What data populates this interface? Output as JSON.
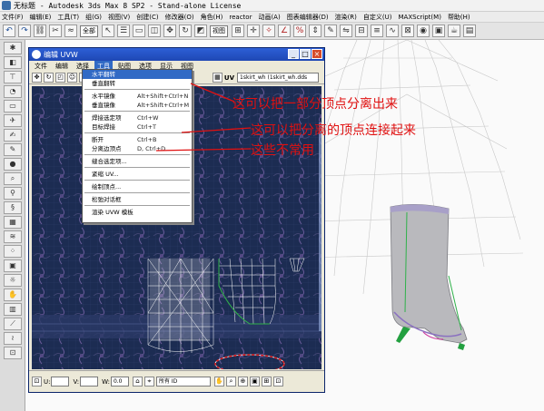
{
  "window": {
    "title": "无标题  -  Autodesk 3ds Max 8 SP2  -  Stand-alone License"
  },
  "menubar": {
    "items": [
      "文件(F)",
      "编辑(E)",
      "工具(T)",
      "组(G)",
      "视图(V)",
      "创建(C)",
      "修改器(O)",
      "角色(H)",
      "reactor",
      "动画(A)",
      "图表编辑器(D)",
      "渲染(R)",
      "自定义(U)",
      "MAXScript(M)",
      "帮助(H)"
    ]
  },
  "toolbar": {
    "selection_filter": "全部",
    "view_dropdown": "视图"
  },
  "uvw_editor": {
    "title": "编辑 UVW",
    "menu": [
      "文件",
      "编辑",
      "选择",
      "工具",
      "贴图",
      "选项",
      "显示",
      "视图"
    ],
    "active_menu": "工具",
    "uvw_label": "UV",
    "map_dropdown": "1skirt_wh (1skirt_wh.dds",
    "bottom": {
      "u_label": "U:",
      "v_label": "V:",
      "w_label": "W:",
      "w_value": "0.0",
      "id_dropdown": "所有 ID"
    }
  },
  "tools_menu": {
    "items": [
      {
        "label": "水平翻转",
        "shortcut": "",
        "highlighted": true
      },
      {
        "label": "垂直翻转",
        "shortcut": "",
        "highlighted": false
      },
      {
        "label": "水平镜像",
        "shortcut": "Alt+Shift+Ctrl+N",
        "highlighted": false
      },
      {
        "label": "垂直镜像",
        "shortcut": "Alt+Shift+Ctrl+M",
        "highlighted": false
      },
      {
        "label": "焊接选定项",
        "shortcut": "Ctrl+W",
        "highlighted": false
      },
      {
        "label": "目标焊接",
        "shortcut": "Ctrl+T",
        "highlighted": false
      },
      {
        "label": "断开",
        "shortcut": "Ctrl+B",
        "highlighted": false
      },
      {
        "label": "分离边顶点",
        "shortcut": "D, Ctrl+D",
        "highlighted": false
      },
      {
        "label": "缝合选定项...",
        "shortcut": "",
        "highlighted": false
      },
      {
        "label": "紧缩 UV...",
        "shortcut": "",
        "highlighted": false
      },
      {
        "label": "绘制顶点...",
        "shortcut": "",
        "highlighted": false
      },
      {
        "label": "松弛对话框",
        "shortcut": "",
        "highlighted": false
      },
      {
        "label": "渲染 UVW 模板",
        "shortcut": "",
        "highlighted": false
      }
    ]
  },
  "annotations": [
    "这可以把一部分顶点分离出来",
    "这可以把分离的顶点连接起来",
    "这些不常用"
  ],
  "colors": {
    "annotation": "#e01010",
    "uv_background": "#1c2c52",
    "uv_selection": "#2fb14a",
    "menu_highlight": "#316ac5",
    "window_title": "#2d5fd6"
  }
}
